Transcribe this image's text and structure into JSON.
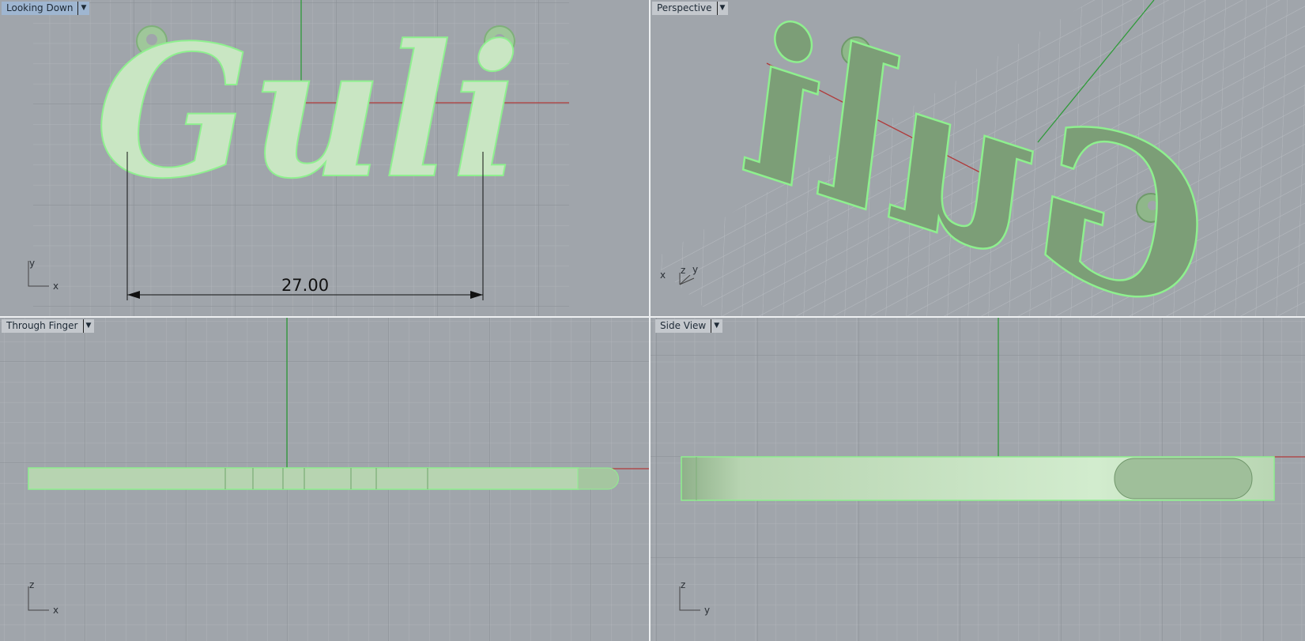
{
  "viewports": [
    {
      "title": "Looking Down",
      "active": true,
      "axes": [
        "y",
        "x"
      ]
    },
    {
      "title": "Perspective",
      "active": false,
      "axes": [
        "x",
        "z",
        "y"
      ]
    },
    {
      "title": "Through Finger",
      "active": false,
      "axes": [
        "z",
        "x"
      ]
    },
    {
      "title": "Side View",
      "active": false,
      "axes": [
        "z",
        "y"
      ]
    }
  ],
  "model": {
    "name_text": "Guli"
  },
  "dimension": {
    "value": "27.00"
  },
  "icons": {
    "dropdown": "chevron-down-icon"
  },
  "colors": {
    "background": "#a0a5ab",
    "grid": "#b3b7bc",
    "model_fill": "#c9e6c3",
    "model_edge": "#8ef08e",
    "x_axis": "#b03a3a",
    "y_axis": "#2f9a3a"
  }
}
